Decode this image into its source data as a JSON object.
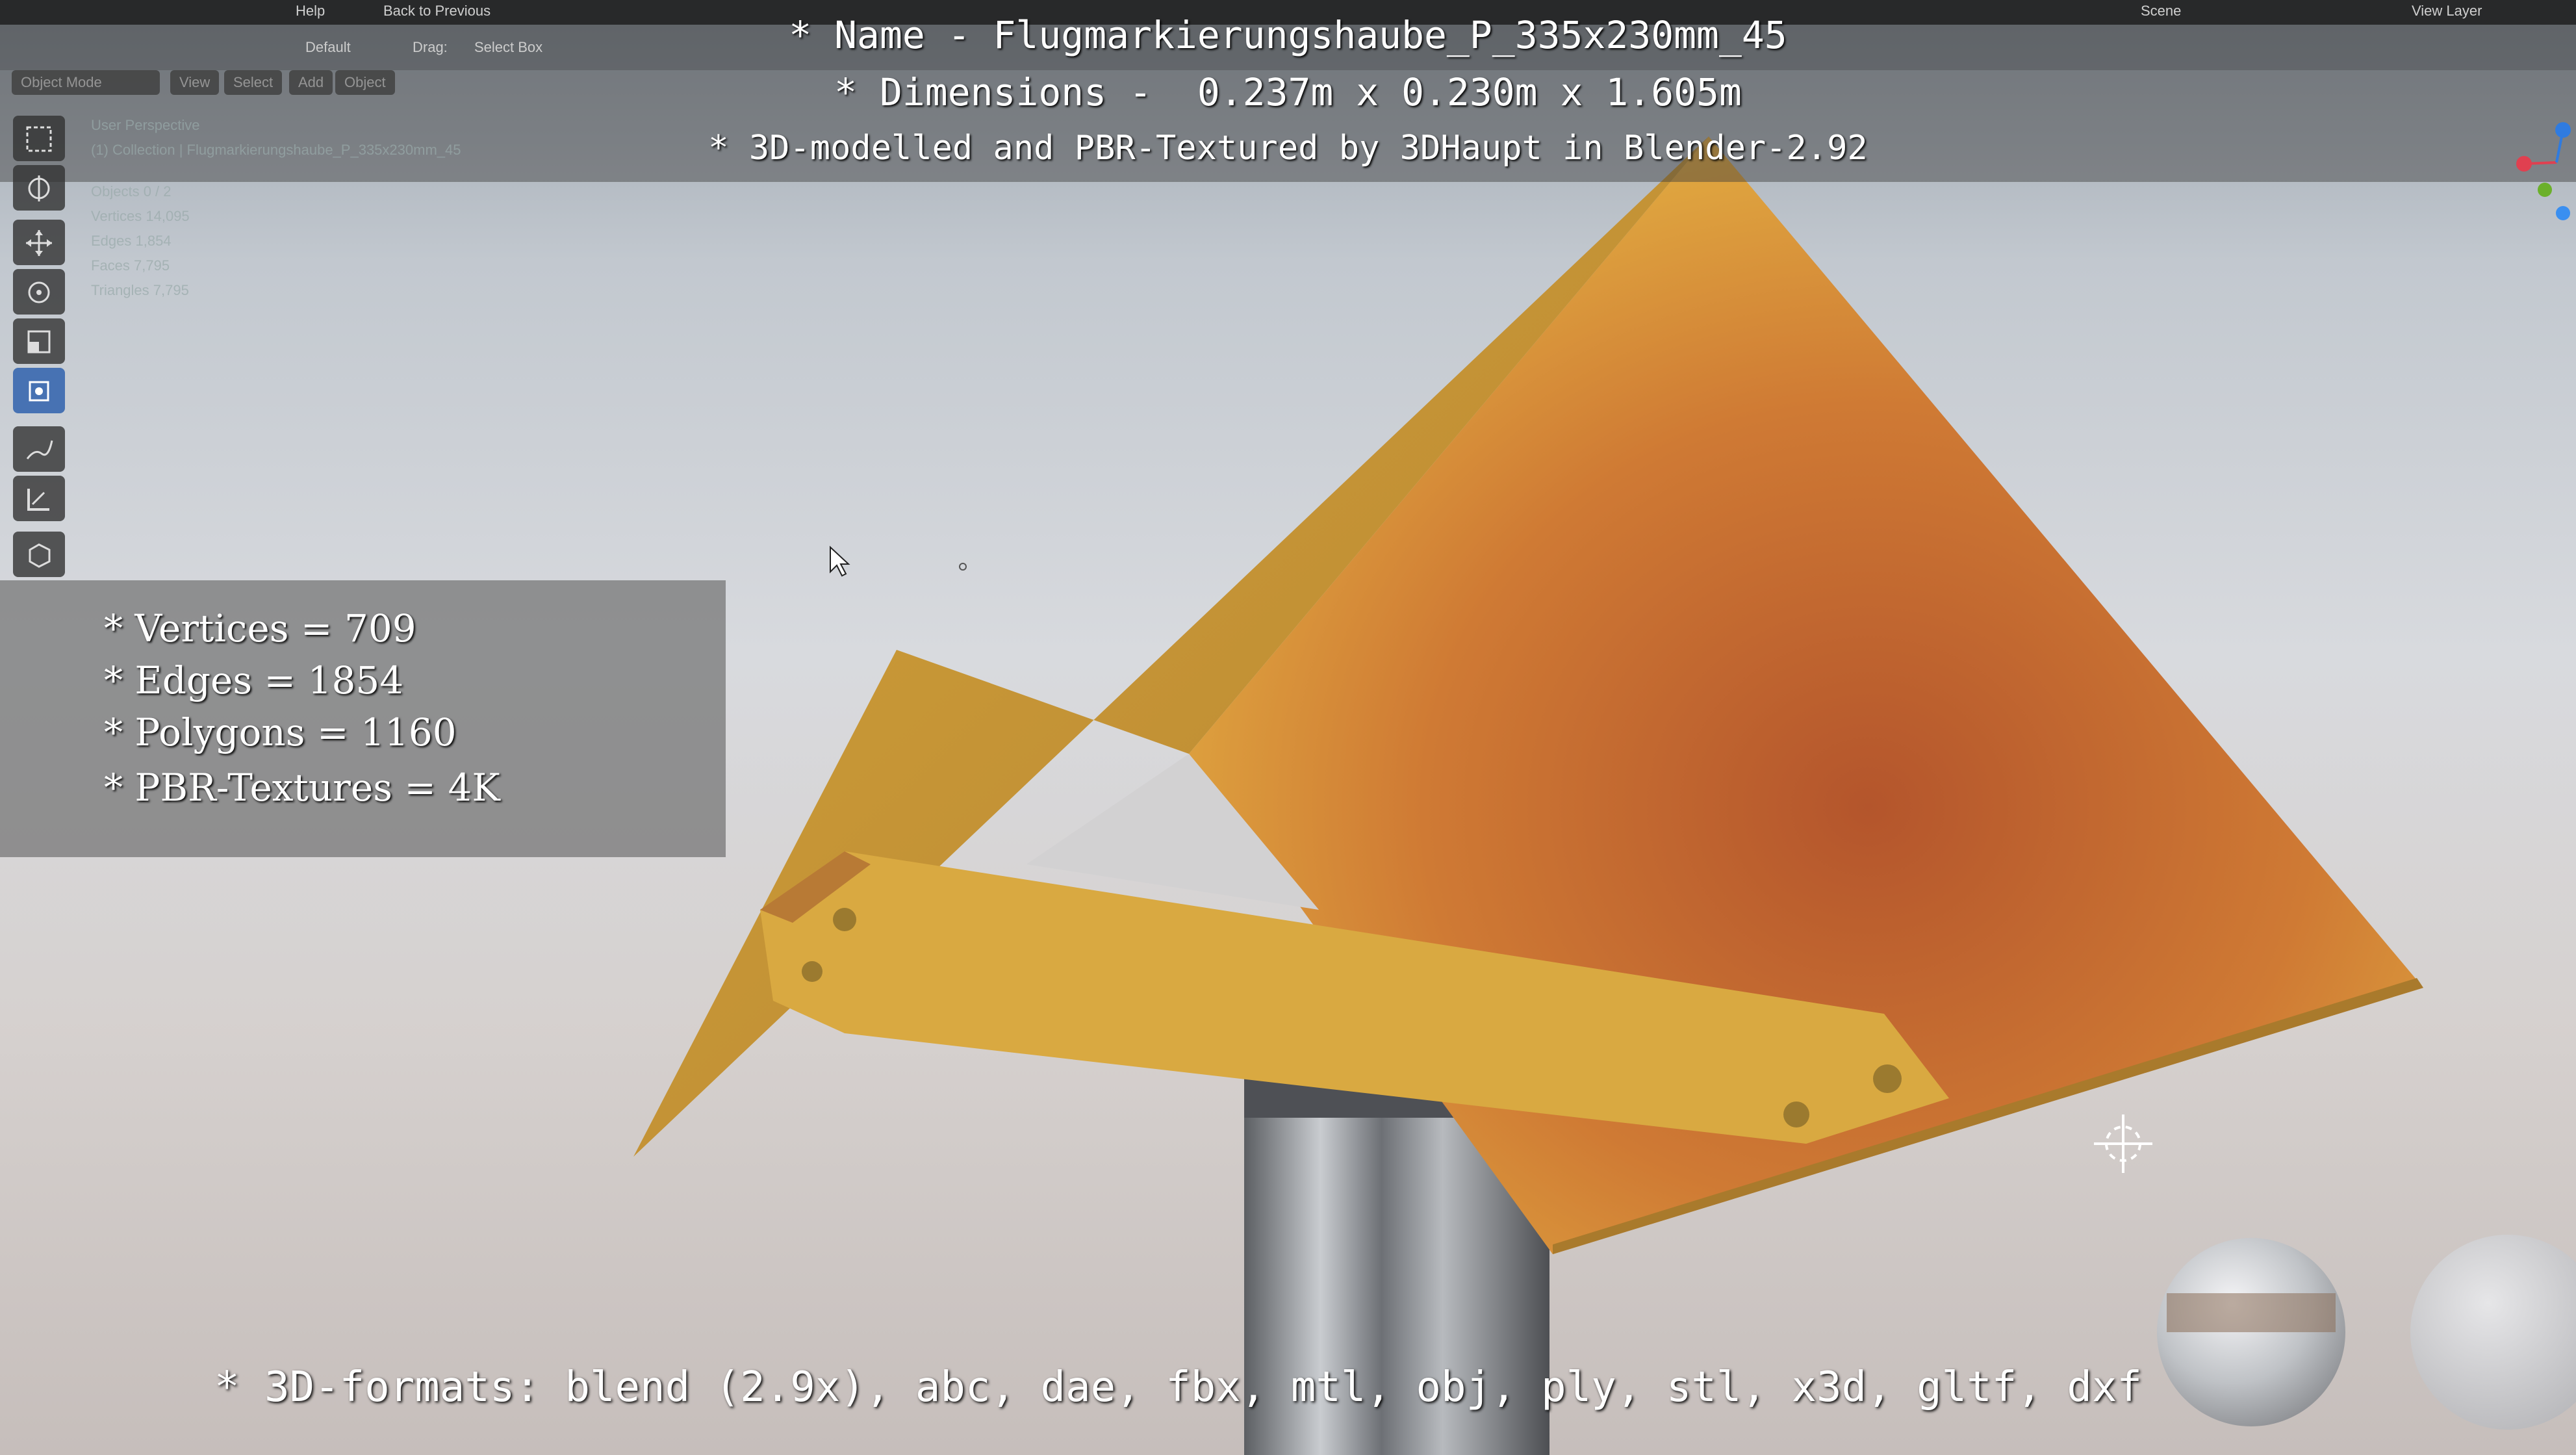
{
  "topbar": {
    "help_menu": "Help",
    "back_button": "Back to Previous",
    "scene_label": "Scene",
    "view_layer_label": "View Layer"
  },
  "header": {
    "orientation_value": "Default",
    "drag_label": "Drag:",
    "drag_value": "Select Box",
    "mode": "Object Mode",
    "menu_view": "View",
    "menu_select": "Select",
    "menu_add": "Add",
    "menu_object": "Object"
  },
  "viewport_info": {
    "perspective": "User Perspective",
    "collection": "(1) Collection | Flugmarkierungshaube_P_335x230mm_45",
    "objects": "Objects   0 / 2",
    "vertices": "Vertices   14,095",
    "edges": "Edges   1,854",
    "faces": "Faces   7,795",
    "triangles": "Triangles   7,795"
  },
  "overlay": {
    "name_line": "* Name - Flugmarkierungshaube_P_335x230mm_45",
    "dimensions_line": "* Dimensions -  0.237m x 0.230m x 1.605m",
    "credit_line": "* 3D-modelled and PBR-Textured by 3DHaupt in Blender-2.92",
    "stats": [
      "* Vertices = 709",
      "* Edges = 1854",
      "* Polygons = 1160",
      "* PBR-Textures = 4K"
    ],
    "formats_line": "* 3D-formats: blend (2.9x), abc, dae, fbx, mtl, obj, ply, stl, x3d, gltf, dxf"
  },
  "colors": {
    "sign_yellow": "#d9a43a",
    "sign_orange": "#c0642e",
    "pole_metal": "#8e9196",
    "active_tool": "#4772b3"
  }
}
